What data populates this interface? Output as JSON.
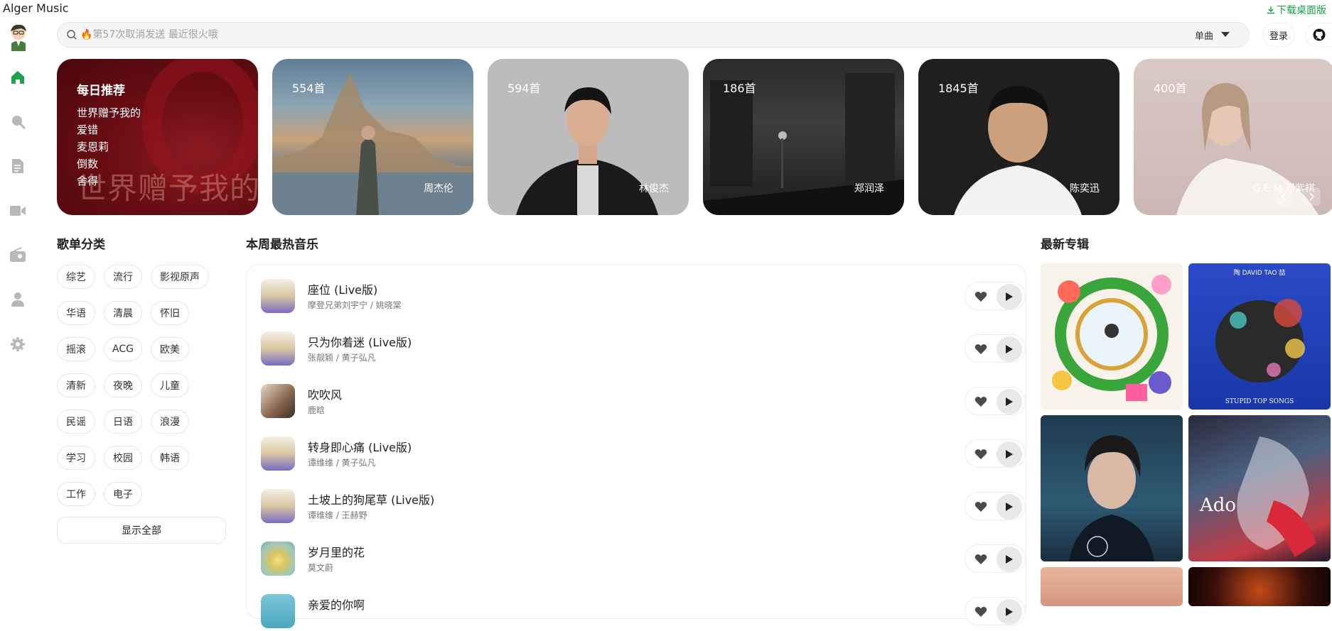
{
  "app": {
    "title": "Alger Music",
    "download_label": "下载桌面版"
  },
  "search": {
    "placeholder": "🔥第57次取消发送 最近很火哦",
    "type_label": "单曲"
  },
  "header": {
    "login_label": "登录"
  },
  "sidebar": {
    "items": [
      {
        "name": "home",
        "icon": "home-icon",
        "active": true
      },
      {
        "name": "search",
        "icon": "search-icon"
      },
      {
        "name": "playlist",
        "icon": "document-icon"
      },
      {
        "name": "mv",
        "icon": "video-icon"
      },
      {
        "name": "radio",
        "icon": "radio-icon"
      },
      {
        "name": "user",
        "icon": "user-icon"
      },
      {
        "name": "settings",
        "icon": "gear-icon"
      }
    ]
  },
  "banner": {
    "daily": {
      "title": "每日推荐",
      "songs": [
        "世界赠予我的",
        "爱错",
        "麦恩莉",
        "倒数",
        "舍得"
      ],
      "cover_text": "世界赠予我的"
    },
    "artists": [
      {
        "count": "554首",
        "name": "周杰伦"
      },
      {
        "count": "594首",
        "name": "林俊杰"
      },
      {
        "count": "186首",
        "name": "郑润泽"
      },
      {
        "count": "1845首",
        "name": "陈奕迅"
      },
      {
        "count": "400首",
        "name": "G.E.M.邓紫棋"
      }
    ]
  },
  "categories": {
    "title": "歌单分类",
    "tags": [
      "综艺",
      "流行",
      "影视原声",
      "华语",
      "清晨",
      "怀旧",
      "摇滚",
      "ACG",
      "欧美",
      "清新",
      "夜晚",
      "儿童",
      "民谣",
      "日语",
      "浪漫",
      "学习",
      "校园",
      "韩语",
      "工作",
      "电子"
    ],
    "show_all_label": "显示全部"
  },
  "hot": {
    "title": "本周最热音乐",
    "songs": [
      {
        "name": "座位 (Live版)",
        "artist": "摩登兄弟刘宇宁 / 姚晓棠"
      },
      {
        "name": "只为你着迷 (Live版)",
        "artist": "张靓颖 / 黄子弘凡"
      },
      {
        "name": "吹吹风",
        "artist": "鹿晗"
      },
      {
        "name": "转身即心痛 (Live版)",
        "artist": "谭维维 / 黄子弘凡"
      },
      {
        "name": "土坡上的狗尾草 (Live版)",
        "artist": "谭维维 / 王赫野"
      },
      {
        "name": "岁月里的花",
        "artist": "莫文蔚"
      },
      {
        "name": "亲爱的你啊",
        "artist": ""
      }
    ]
  },
  "albums": {
    "title": "最新专辑",
    "album2_text": "STUPID TOP SONGS",
    "album2_top": "陶 DAVID TAO 喆",
    "album4_text": "Ado"
  },
  "colors": {
    "accent": "#16a34a",
    "text": "#222222",
    "muted": "#777777"
  }
}
